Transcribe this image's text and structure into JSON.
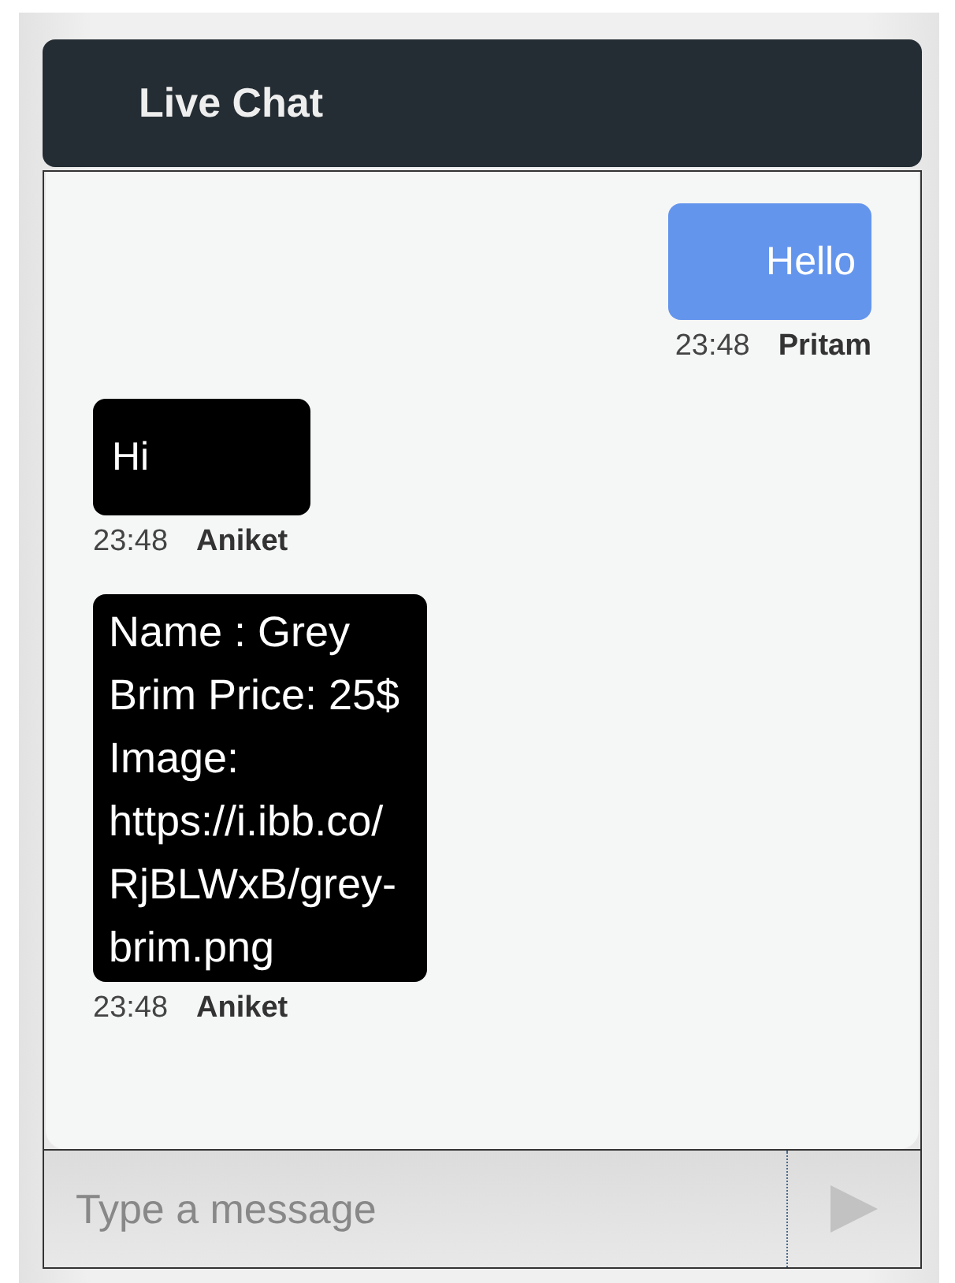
{
  "header": {
    "title": "Live Chat"
  },
  "messages": [
    {
      "kind": "sent",
      "text": "Hello",
      "time": "23:48",
      "author": "Pritam"
    },
    {
      "kind": "received",
      "text": "Hi",
      "time": "23:48",
      "author": "Aniket"
    },
    {
      "kind": "received",
      "text": "Name : Grey Brim Price: 25$ Image: https://i.ibb.co/RjBLWxB/grey-brim.png",
      "time": "23:48",
      "author": "Aniket"
    }
  ],
  "composer": {
    "placeholder": "Type a message"
  }
}
